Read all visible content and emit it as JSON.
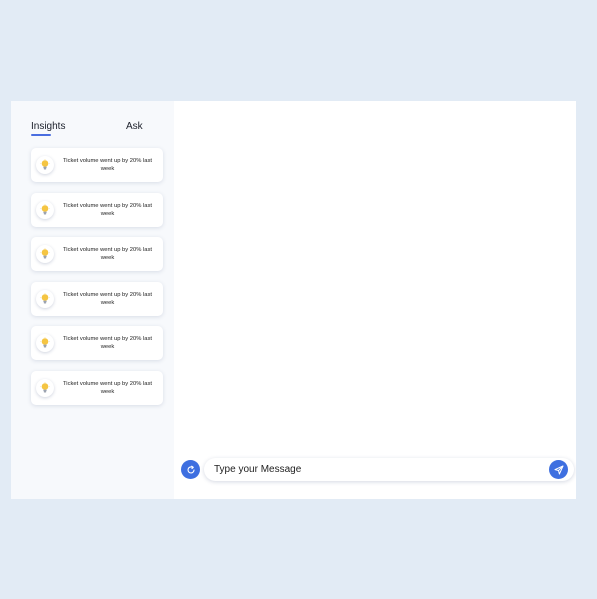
{
  "tabs": {
    "insights_label": "Insights",
    "ask_label": "Ask",
    "active": "insights"
  },
  "insights": [
    {
      "text": "Ticket volume went up by 20% last week",
      "icon": "lightbulb-icon"
    },
    {
      "text": "Ticket volume went up by 20% last week",
      "icon": "lightbulb-icon"
    },
    {
      "text": "Ticket volume went up by 20% last week",
      "icon": "lightbulb-icon"
    },
    {
      "text": "Ticket volume went up by 20% last week",
      "icon": "lightbulb-icon"
    },
    {
      "text": "Ticket volume went up by 20% last week",
      "icon": "lightbulb-icon"
    },
    {
      "text": "Ticket volume went up by 20% last week",
      "icon": "lightbulb-icon"
    }
  ],
  "chat": {
    "input_placeholder": "Type your Message",
    "input_value": "",
    "refresh_icon": "refresh-icon",
    "send_icon": "send-icon"
  },
  "colors": {
    "page_background": "#e2ebf5",
    "accent": "#3e6fe0",
    "sidebar_background": "#f7f9fc",
    "bulb": "#f5c542"
  }
}
